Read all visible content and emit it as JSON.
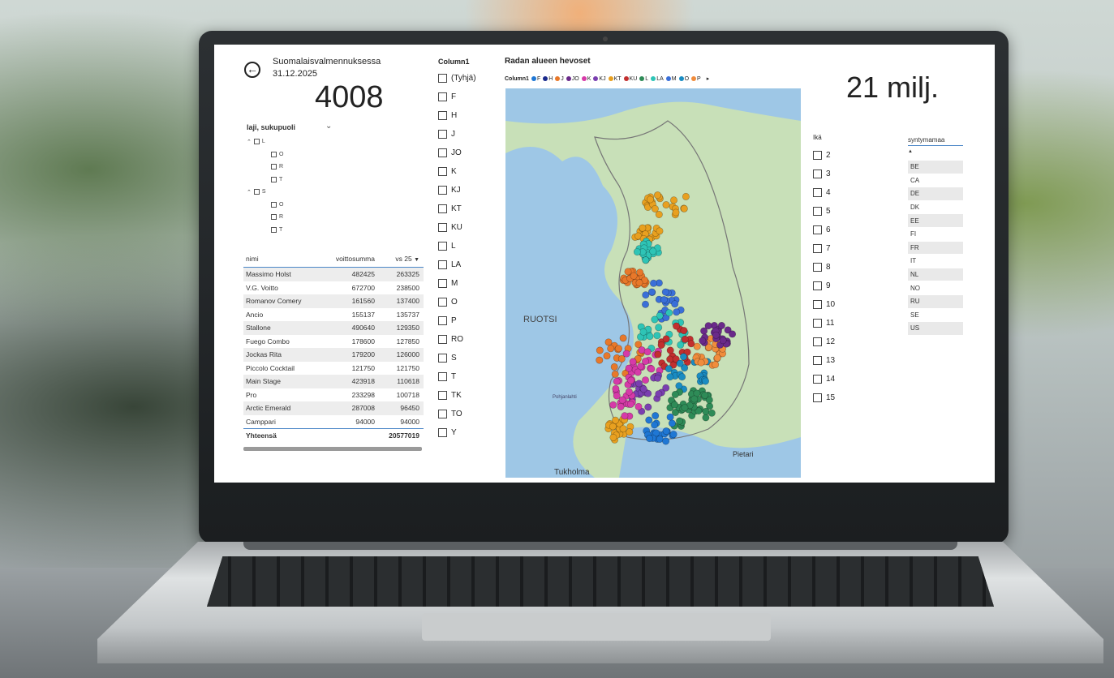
{
  "header": {
    "title": "Suomalaisvalmennuksessa",
    "date": "31.12.2025",
    "horse_count": "4008",
    "total_winnings": "21 milj."
  },
  "gender_slicer": {
    "title": "laji, sukupuoli",
    "tree": [
      {
        "label": "L",
        "children": [
          "O",
          "R",
          "T"
        ]
      },
      {
        "label": "S",
        "children": [
          "O",
          "R",
          "T"
        ]
      }
    ]
  },
  "winnings_table": {
    "columns": [
      "nimi",
      "voittosumma",
      "vs 25"
    ],
    "rows": [
      [
        "Massimo Holst",
        "482425",
        "263325"
      ],
      [
        "V.G. Voitto",
        "672700",
        "238500"
      ],
      [
        "Romanov Comery",
        "161560",
        "137400"
      ],
      [
        "Ancio",
        "155137",
        "135737"
      ],
      [
        "Stallone",
        "490640",
        "129350"
      ],
      [
        "Fuego Combo",
        "178600",
        "127850"
      ],
      [
        "Jockas Rita",
        "179200",
        "126000"
      ],
      [
        "Piccolo Cocktail",
        "121750",
        "121750"
      ],
      [
        "Main Stage",
        "423918",
        "110618"
      ],
      [
        "Pro",
        "233298",
        "100718"
      ],
      [
        "Arctic Emerald",
        "287008",
        "96450"
      ],
      [
        "Camppari",
        "94000",
        "94000"
      ]
    ],
    "total_label": "Yhteensä",
    "total_value": "20577019"
  },
  "column_slicer": {
    "title": "Column1",
    "items": [
      "(Tyhjä)",
      "F",
      "H",
      "J",
      "JO",
      "K",
      "KJ",
      "KT",
      "KU",
      "L",
      "LA",
      "M",
      "O",
      "P",
      "RO",
      "S",
      "T",
      "TK",
      "TO",
      "Y"
    ]
  },
  "map": {
    "title": "Radan alueen hevoset",
    "legend_label": "Column1",
    "legend": [
      {
        "label": "F",
        "color": "#1f77d4"
      },
      {
        "label": "H",
        "color": "#1a2a8c"
      },
      {
        "label": "J",
        "color": "#e8782a"
      },
      {
        "label": "JO",
        "color": "#6a2a8a"
      },
      {
        "label": "K",
        "color": "#d63aa8"
      },
      {
        "label": "KJ",
        "color": "#7a3fb0"
      },
      {
        "label": "KT",
        "color": "#e8a020"
      },
      {
        "label": "KU",
        "color": "#c22f2f"
      },
      {
        "label": "L",
        "color": "#2e8b57"
      },
      {
        "label": "LA",
        "color": "#2ec4b6"
      },
      {
        "label": "M",
        "color": "#3a6fd8"
      },
      {
        "label": "O",
        "color": "#1a8cc2"
      },
      {
        "label": "P",
        "color": "#f08c3c"
      }
    ],
    "label_ruotsi": "RUOTSI",
    "label_bay": "Pohjanlahti",
    "label_stockholm": "Tukholma",
    "label_pietari": "Pietari",
    "colors": {
      "land": "#c8e0b8",
      "water": "#9ec7e6"
    }
  },
  "age_slicer": {
    "title": "Ikä",
    "items": [
      "2",
      "3",
      "4",
      "5",
      "6",
      "7",
      "8",
      "9",
      "10",
      "11",
      "12",
      "13",
      "14",
      "15"
    ]
  },
  "country_slicer": {
    "title": "syntymamaa",
    "items": [
      "BE",
      "CA",
      "DE",
      "DK",
      "EE",
      "FI",
      "FR",
      "IT",
      "NL",
      "NO",
      "RU",
      "SE",
      "US"
    ]
  }
}
